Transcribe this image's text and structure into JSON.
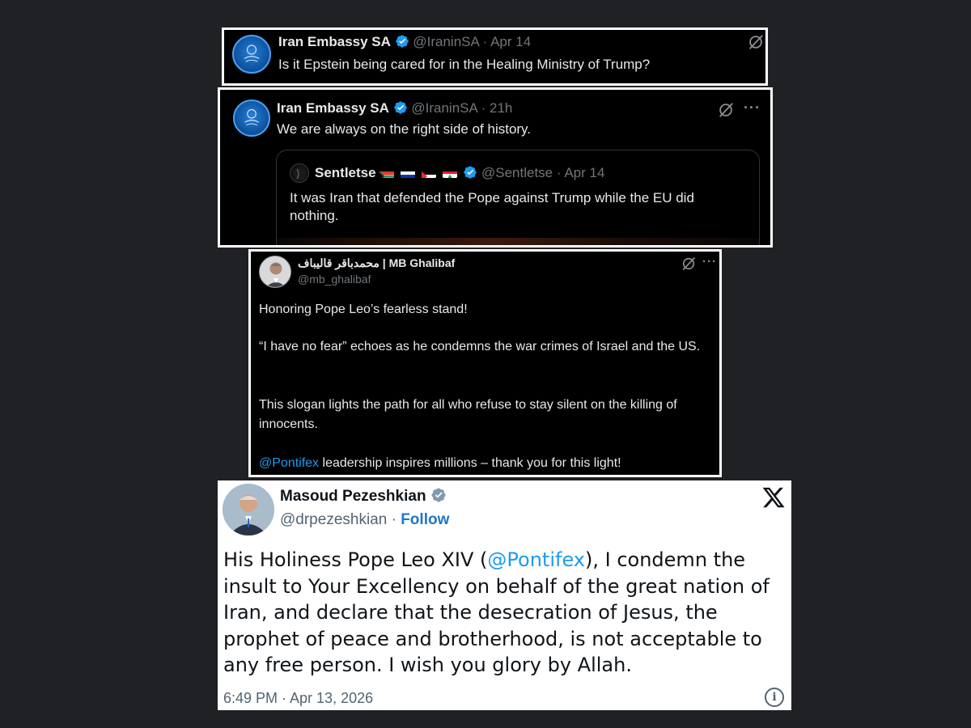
{
  "tweet1": {
    "name": "Iran Embassy SA",
    "handle": "@IraninSA",
    "date": "· Apr 14",
    "text": "Is it Epstein being cared for in the Healing Ministry of Trump?"
  },
  "tweet2": {
    "name": "Iran Embassy SA",
    "handle": "@IraninSA",
    "date": "· 21h",
    "more": "···",
    "text": "We are always on the right side of history.",
    "quote": {
      "name": "Sentletse",
      "handle": "@Sentletse",
      "date": "· Apr 14",
      "text": "It was Iran that defended the Pope against Trump while the EU did nothing."
    }
  },
  "tweet3": {
    "name": "محمدباقر قالیباف | MB Ghalibaf",
    "handle": "@mb_ghalibaf",
    "more": "···",
    "para1": "Honoring Pope Leo’s fearless stand!",
    "para2": "“I have no fear” echoes as he condemns the war crimes of Israel and the US.",
    "para3": "This slogan lights the path for all who refuse to stay silent on the killing of innocents.",
    "para4_mention": "@Pontifex",
    "para4_rest": " leadership inspires millions – thank you for this light!"
  },
  "tweet4": {
    "name": "Masoud Pezeshkian",
    "handle": "@drpezeshkian",
    "sep": " · ",
    "follow": "Follow",
    "x_logo": "𝕏",
    "text_a": "His Holiness Pope Leo XIV (",
    "mention": "@Pontifex",
    "text_b": "), I condemn the insult to Your Excellency on behalf of the great nation of Iran, and declare that the desecration of Jesus, the prophet of peace and brotherhood, is not acceptable to any free person. I wish you glory by Allah.",
    "timestamp": "6:49 PM · Apr 13, 2026",
    "info_icon": "i"
  },
  "icons": {
    "grok": "grok-icon",
    "more": "more-options-icon",
    "verified": "verified-badge-icon",
    "info": "info-icon",
    "x": "x-logo-icon"
  },
  "colors": {
    "accent": "#1d9bf0",
    "background": "#202124",
    "tweet_dark": "#000000",
    "tweet_light": "#ffffff"
  }
}
